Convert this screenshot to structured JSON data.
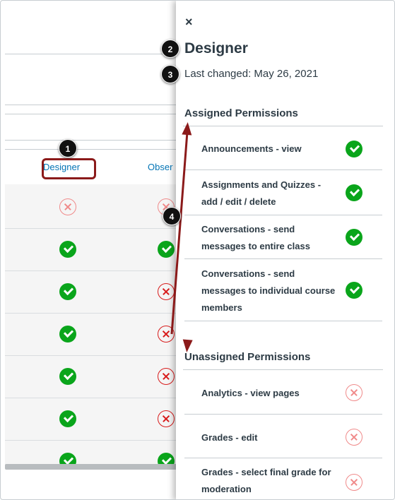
{
  "table": {
    "columns": [
      {
        "label": "Designer"
      },
      {
        "label": "Obser"
      }
    ],
    "rows": [
      [
        "x-light",
        "x-light"
      ],
      [
        "check",
        "check"
      ],
      [
        "check",
        "x"
      ],
      [
        "check",
        "x"
      ],
      [
        "check",
        "x"
      ],
      [
        "check",
        "x"
      ],
      [
        "check",
        "check"
      ]
    ]
  },
  "tray": {
    "close_label": "×",
    "title": "Designer",
    "last_changed": "Last changed: May 26, 2021",
    "assigned": {
      "heading": "Assigned Permissions",
      "items": [
        {
          "label": "Announcements - view",
          "status": "check"
        },
        {
          "label": "Assignments and Quizzes - add / edit / delete",
          "status": "check"
        },
        {
          "label": "Conversations - send messages to entire class",
          "status": "check"
        },
        {
          "label": "Conversations - send messages to individual course members",
          "status": "check"
        }
      ]
    },
    "unassigned": {
      "heading": "Unassigned Permissions",
      "items": [
        {
          "label": "Analytics - view pages",
          "status": "x"
        },
        {
          "label": "Grades - edit",
          "status": "x"
        },
        {
          "label": "Grades - select final grade for moderation",
          "status": "x"
        }
      ]
    }
  },
  "callouts": [
    "1",
    "2",
    "3",
    "4"
  ],
  "colors": {
    "link": "#0374b5",
    "check": "#0aa51b",
    "x": "#d81b1b",
    "callout_outline": "#8b1a1a",
    "arrow": "#8b1a1a"
  }
}
